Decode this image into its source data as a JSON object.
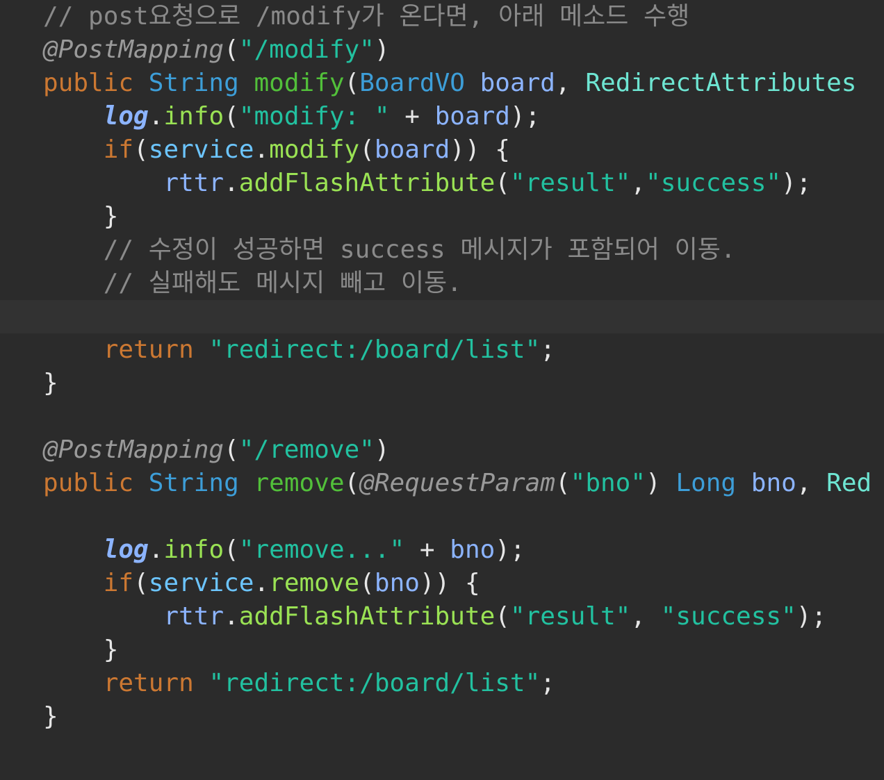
{
  "editor": {
    "theme_colors": {
      "background": "#2b2b2b",
      "current_line": "#323232",
      "comment": "#8a8a8a",
      "annotation": "#9a9a9a",
      "keyword": "#cc7832",
      "type": "#3d9ed8",
      "method_decl": "#52c03a",
      "parameter": "#8cb4ff",
      "string": "#22c1a0",
      "field": "#6cc5ff",
      "method_call": "#9ae254"
    },
    "lines": [
      {
        "tokens": [
          {
            "t": "// post요청으로 /modify가 온다면, 아래 메소드 수행",
            "c": "cmt"
          }
        ]
      },
      {
        "tokens": [
          {
            "t": "@PostMapping",
            "c": "ann"
          },
          {
            "t": "(",
            "c": "pun"
          },
          {
            "t": "\"/modify\"",
            "c": "str"
          },
          {
            "t": ")",
            "c": "pun"
          }
        ]
      },
      {
        "tokens": [
          {
            "t": "public",
            "c": "kw"
          },
          {
            "t": " ",
            "c": "pun"
          },
          {
            "t": "String",
            "c": "typ"
          },
          {
            "t": " ",
            "c": "pun"
          },
          {
            "t": "modify",
            "c": "mth"
          },
          {
            "t": "(",
            "c": "pun"
          },
          {
            "t": "BoardVO",
            "c": "typ"
          },
          {
            "t": " ",
            "c": "pun"
          },
          {
            "t": "board",
            "c": "prm"
          },
          {
            "t": ", ",
            "c": "pun"
          },
          {
            "t": "RedirectAttributes",
            "c": "cls"
          }
        ]
      },
      {
        "tokens": [
          {
            "t": "    ",
            "c": "pun"
          },
          {
            "t": "log",
            "c": "log"
          },
          {
            "t": ".",
            "c": "pun"
          },
          {
            "t": "info",
            "c": "call"
          },
          {
            "t": "(",
            "c": "pun"
          },
          {
            "t": "\"modify: \"",
            "c": "str"
          },
          {
            "t": " + ",
            "c": "pun"
          },
          {
            "t": "board",
            "c": "prm"
          },
          {
            "t": ");",
            "c": "pun"
          }
        ]
      },
      {
        "tokens": [
          {
            "t": "    ",
            "c": "pun"
          },
          {
            "t": "if",
            "c": "kw"
          },
          {
            "t": "(",
            "c": "pun"
          },
          {
            "t": "service",
            "c": "fld"
          },
          {
            "t": ".",
            "c": "pun"
          },
          {
            "t": "modify",
            "c": "call"
          },
          {
            "t": "(",
            "c": "pun"
          },
          {
            "t": "board",
            "c": "prm"
          },
          {
            "t": ")) {",
            "c": "pun"
          }
        ]
      },
      {
        "tokens": [
          {
            "t": "        ",
            "c": "pun"
          },
          {
            "t": "rttr",
            "c": "prm"
          },
          {
            "t": ".",
            "c": "pun"
          },
          {
            "t": "addFlashAttribute",
            "c": "call"
          },
          {
            "t": "(",
            "c": "pun"
          },
          {
            "t": "\"result\"",
            "c": "str"
          },
          {
            "t": ",",
            "c": "pun"
          },
          {
            "t": "\"success\"",
            "c": "str"
          },
          {
            "t": ");",
            "c": "pun"
          }
        ]
      },
      {
        "tokens": [
          {
            "t": "    }",
            "c": "pun"
          }
        ]
      },
      {
        "tokens": [
          {
            "t": "    // 수정이 성공하면 success 메시지가 포함되어 이동.",
            "c": "cmt"
          }
        ]
      },
      {
        "tokens": [
          {
            "t": "    // 실패해도 메시지 빼고 이동.",
            "c": "cmt"
          }
        ]
      },
      {
        "tokens": [],
        "current": true
      },
      {
        "tokens": [
          {
            "t": "    ",
            "c": "pun"
          },
          {
            "t": "return",
            "c": "kw"
          },
          {
            "t": " ",
            "c": "pun"
          },
          {
            "t": "\"redirect:/board/list\"",
            "c": "str"
          },
          {
            "t": ";",
            "c": "pun"
          }
        ]
      },
      {
        "tokens": [
          {
            "t": "}",
            "c": "pun"
          }
        ]
      },
      {
        "tokens": []
      },
      {
        "tokens": [
          {
            "t": "@PostMapping",
            "c": "ann"
          },
          {
            "t": "(",
            "c": "pun"
          },
          {
            "t": "\"/remove\"",
            "c": "str"
          },
          {
            "t": ")",
            "c": "pun"
          }
        ]
      },
      {
        "tokens": [
          {
            "t": "public",
            "c": "kw"
          },
          {
            "t": " ",
            "c": "pun"
          },
          {
            "t": "String",
            "c": "typ"
          },
          {
            "t": " ",
            "c": "pun"
          },
          {
            "t": "remove",
            "c": "mth"
          },
          {
            "t": "(",
            "c": "pun"
          },
          {
            "t": "@RequestParam",
            "c": "ann"
          },
          {
            "t": "(",
            "c": "pun"
          },
          {
            "t": "\"bno\"",
            "c": "str"
          },
          {
            "t": ") ",
            "c": "pun"
          },
          {
            "t": "Long",
            "c": "typ"
          },
          {
            "t": " ",
            "c": "pun"
          },
          {
            "t": "bno",
            "c": "prm"
          },
          {
            "t": ", ",
            "c": "pun"
          },
          {
            "t": "Red",
            "c": "cls"
          }
        ]
      },
      {
        "tokens": []
      },
      {
        "tokens": [
          {
            "t": "    ",
            "c": "pun"
          },
          {
            "t": "log",
            "c": "log"
          },
          {
            "t": ".",
            "c": "pun"
          },
          {
            "t": "info",
            "c": "call"
          },
          {
            "t": "(",
            "c": "pun"
          },
          {
            "t": "\"remove...\"",
            "c": "str"
          },
          {
            "t": " + ",
            "c": "pun"
          },
          {
            "t": "bno",
            "c": "prm"
          },
          {
            "t": ");",
            "c": "pun"
          }
        ]
      },
      {
        "tokens": [
          {
            "t": "    ",
            "c": "pun"
          },
          {
            "t": "if",
            "c": "kw"
          },
          {
            "t": "(",
            "c": "pun"
          },
          {
            "t": "service",
            "c": "fld"
          },
          {
            "t": ".",
            "c": "pun"
          },
          {
            "t": "remove",
            "c": "call"
          },
          {
            "t": "(",
            "c": "pun"
          },
          {
            "t": "bno",
            "c": "prm"
          },
          {
            "t": ")) {",
            "c": "pun"
          }
        ]
      },
      {
        "tokens": [
          {
            "t": "        ",
            "c": "pun"
          },
          {
            "t": "rttr",
            "c": "prm"
          },
          {
            "t": ".",
            "c": "pun"
          },
          {
            "t": "addFlashAttribute",
            "c": "call"
          },
          {
            "t": "(",
            "c": "pun"
          },
          {
            "t": "\"result\"",
            "c": "str"
          },
          {
            "t": ", ",
            "c": "pun"
          },
          {
            "t": "\"success\"",
            "c": "str"
          },
          {
            "t": ");",
            "c": "pun"
          }
        ]
      },
      {
        "tokens": [
          {
            "t": "    }",
            "c": "pun"
          }
        ]
      },
      {
        "tokens": [
          {
            "t": "    ",
            "c": "pun"
          },
          {
            "t": "return",
            "c": "kw"
          },
          {
            "t": " ",
            "c": "pun"
          },
          {
            "t": "\"redirect:/board/list\"",
            "c": "str"
          },
          {
            "t": ";",
            "c": "pun"
          }
        ]
      },
      {
        "tokens": [
          {
            "t": "}",
            "c": "pun"
          }
        ]
      }
    ]
  }
}
